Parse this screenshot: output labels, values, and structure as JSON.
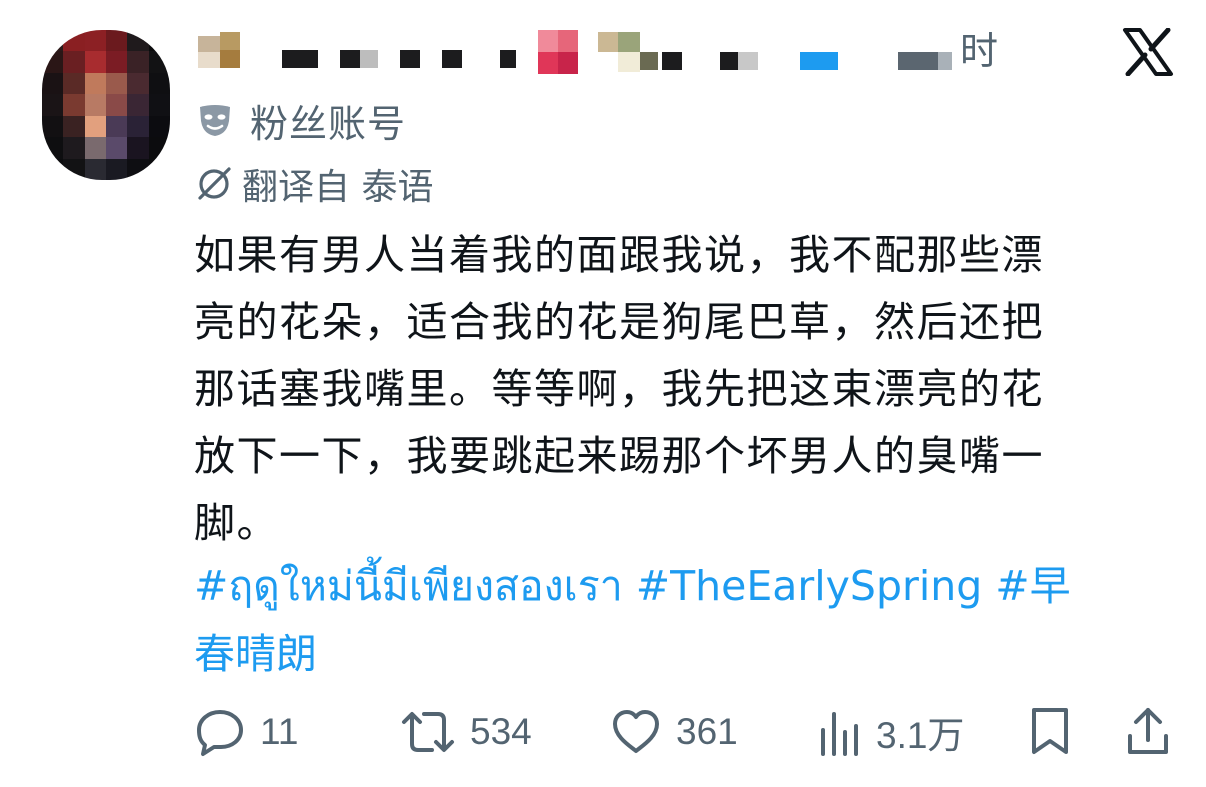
{
  "header": {
    "time_suffix": "时"
  },
  "account": {
    "label": "粉丝账号",
    "icon": "mask-icon"
  },
  "translation": {
    "label": "翻译自 泰语",
    "icon": "globe-slash-icon"
  },
  "post": {
    "lines": [
      "如果有男人当着我的面跟我说，我不配那些漂",
      "亮的花朵，适合我的花是狗尾巴草，然后还把",
      "那话塞我嘴里。等等啊，我先把这束漂亮的花",
      "放下一下，我要跳起来踢那个坏男人的臭嘴一",
      "脚。"
    ],
    "hashtag_lines": [
      "#ฤดูใหม่นี้มีเพียงสองเรา #TheEarlySpring #早",
      "春晴朗"
    ]
  },
  "actions": {
    "reply_count": "11",
    "repost_count": "534",
    "like_count": "361",
    "views_count": "3.1万"
  },
  "colors": {
    "text": "#0f1419",
    "muted": "#536471",
    "link": "#1d9bf0"
  }
}
